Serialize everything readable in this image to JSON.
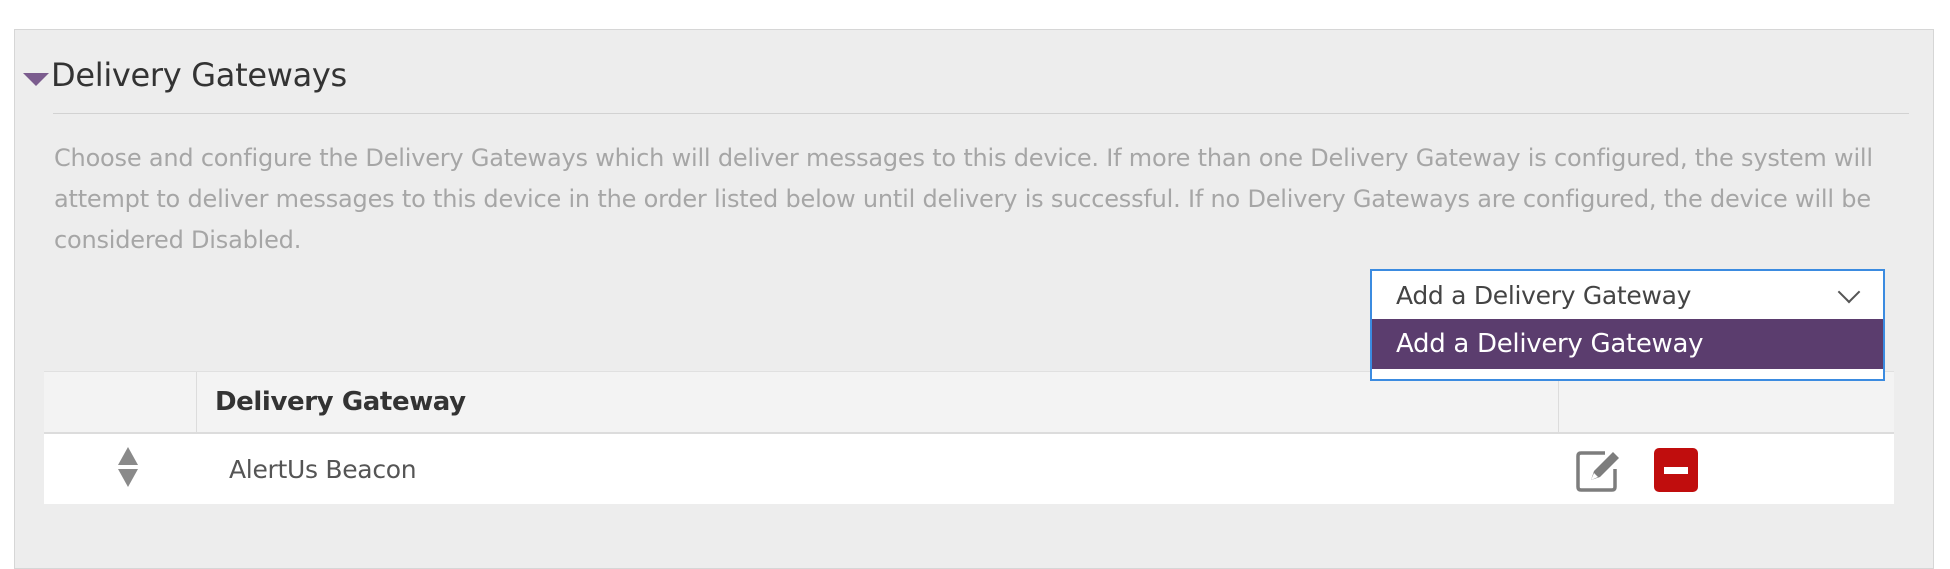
{
  "section": {
    "title": "Delivery Gateways",
    "description": "Choose and configure the Delivery Gateways which will deliver messages to this device. If more than one Delivery Gateway is configured, the system will attempt to deliver messages to this device in the order listed below until delivery is successful. If no Delivery Gateways are configured, the device will be considered Disabled."
  },
  "gateway_select": {
    "value": "Add a Delivery Gateway",
    "options": [
      "Add a Delivery Gateway"
    ],
    "highlighted_option": "Add a Delivery Gateway"
  },
  "table": {
    "columns": [
      "",
      "Delivery Gateway",
      ""
    ],
    "rows": [
      {
        "name": "AlertUs Beacon"
      }
    ]
  },
  "colors": {
    "accent": "#5b3d6e",
    "focus_border": "#3b8be0",
    "remove": "#c00d0d"
  },
  "icons": {
    "collapse": "caret-down-icon",
    "select": "chevron-down-icon",
    "sort": "sort-handle-icon",
    "edit": "edit-icon",
    "remove": "remove-icon"
  }
}
